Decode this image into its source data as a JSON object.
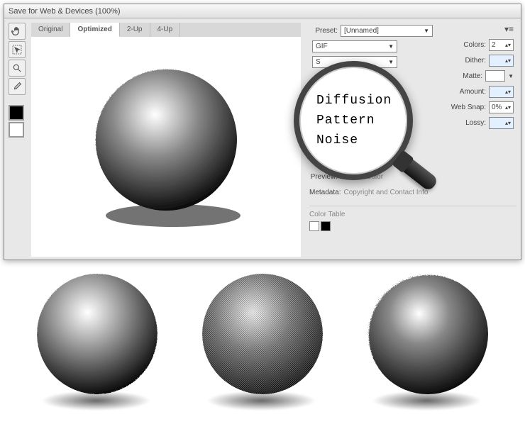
{
  "window": {
    "title": "Save for Web & Devices (100%)"
  },
  "tabs": {
    "original": "Original",
    "optimized": "Optimized",
    "two_up": "2-Up",
    "four_up": "4-Up"
  },
  "settings": {
    "preset_label": "Preset:",
    "preset_value": "[Unnamed]",
    "format": "GIF",
    "colors_label": "Colors:",
    "colors_value": "2",
    "dither_label": "Dither:",
    "matte_label": "Matte:",
    "amount_label": "Amount:",
    "websnap_label": "Web Snap:",
    "websnap_value": "0%",
    "lossy_label": "Lossy:",
    "preview_label": "Preview:",
    "preview_value": "Monitor Color",
    "metadata_label": "Metadata:",
    "metadata_value": "Copyright and Contact Info",
    "colortable_label": "Color Table"
  },
  "dither_options": {
    "diffusion": "Diffusion",
    "pattern": "Pattern",
    "noise": "Noise"
  }
}
